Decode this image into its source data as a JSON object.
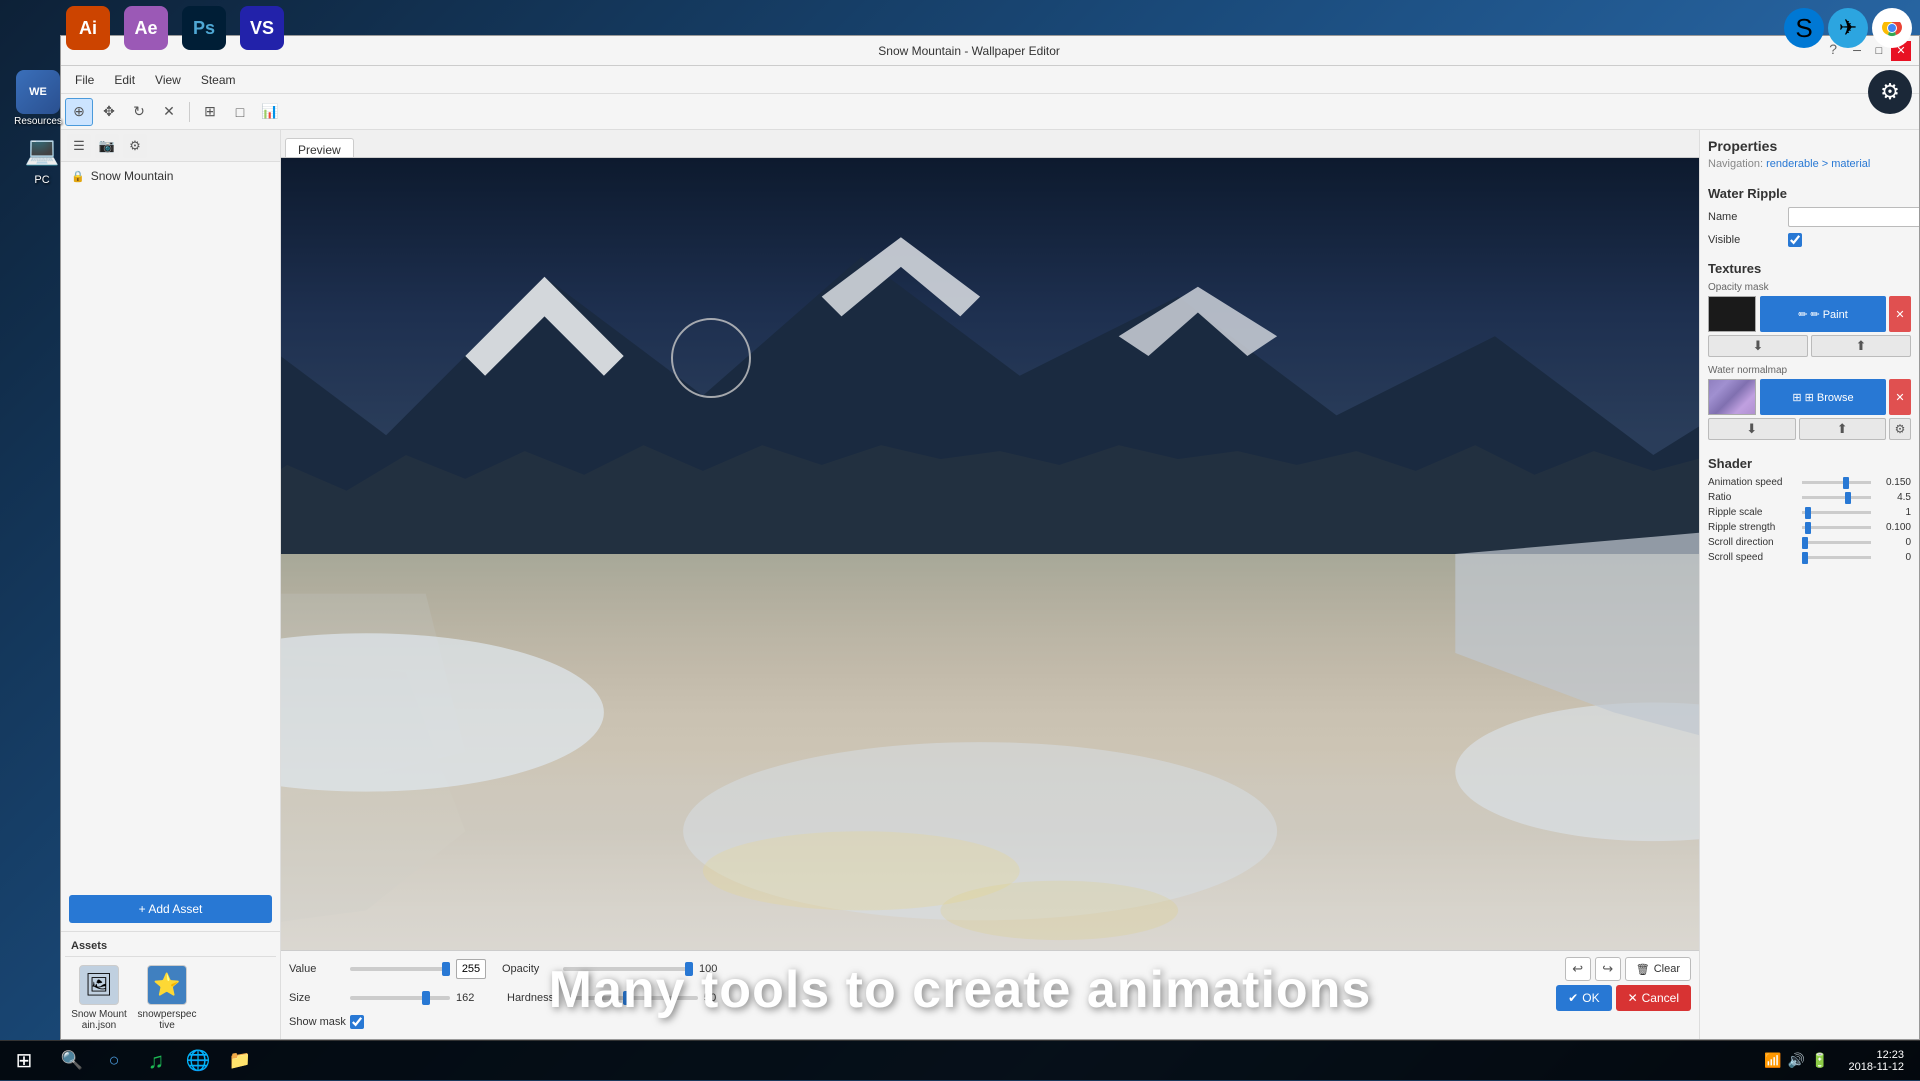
{
  "window": {
    "title": "Snow Mountain - Wallpaper Editor",
    "help_btn": "?",
    "minimize_btn": "─",
    "maximize_btn": "□",
    "close_btn": "✕"
  },
  "menu": {
    "items": [
      "File",
      "Edit",
      "View",
      "Steam"
    ]
  },
  "toolbar": {
    "tools": [
      "⊕",
      "✥",
      "↻",
      "✕",
      "⊞",
      "□",
      "📊"
    ]
  },
  "left_panel": {
    "tools": [
      "☰",
      "📷",
      "⚙"
    ],
    "project_item": "Snow Mountain",
    "add_asset_btn": "+ Add Asset"
  },
  "assets": {
    "label": "Assets",
    "items": [
      {
        "icon": "🖼",
        "label": "Snow Mountain.json"
      },
      {
        "icon": "⭐",
        "label": "snowperspective"
      }
    ]
  },
  "preview": {
    "tab": "Preview"
  },
  "brush_controls": {
    "value_label": "Value",
    "value": "255",
    "size_label": "Size",
    "size": "162",
    "opacity_label": "Opacity",
    "opacity": "100",
    "hardness_label": "Hardness",
    "hardness": "50",
    "show_mask_label": "Show mask",
    "undo_btn": "↩",
    "redo_btn": "↪",
    "clear_btn": "Clear",
    "ok_btn": "OK",
    "cancel_btn": "Cancel"
  },
  "properties": {
    "title": "Properties",
    "nav": "Navigation: renderable > material",
    "nav_link": "renderable > material",
    "section_title": "Water Ripple",
    "name_label": "Name",
    "name_value": "",
    "visible_label": "Visible",
    "textures_title": "Textures",
    "opacity_mask_label": "Opacity mask",
    "paint_btn": "✏ Paint",
    "browse_btn": "⊞ Browse",
    "water_normalmap_label": "Water normalmap",
    "shader_title": "Shader",
    "shader_props": [
      {
        "label": "Animation speed",
        "value": "0.150",
        "thumb_pct": 60
      },
      {
        "label": "Ratio",
        "value": "4.5",
        "thumb_pct": 62
      },
      {
        "label": "Ripple scale",
        "value": "1",
        "thumb_pct": 5
      },
      {
        "label": "Ripple strength",
        "value": "0.100",
        "thumb_pct": 5
      },
      {
        "label": "Scroll direction",
        "value": "0",
        "thumb_pct": 0
      },
      {
        "label": "Scroll speed",
        "value": "0",
        "thumb_pct": 0
      }
    ]
  },
  "taskbar": {
    "time": "12:23",
    "date": "2018-11-12"
  },
  "overlay": {
    "text": "Many tools to create animations"
  },
  "desktop_icons": [
    {
      "icon": "💻",
      "label": "PC"
    }
  ],
  "apps": [
    {
      "bg": "#cc4400",
      "label": "Ai",
      "text_label": "Ai"
    },
    {
      "bg": "#cc0000",
      "label": "Ae",
      "text_label": "Ae"
    },
    {
      "bg": "#220066",
      "label": "Ps",
      "text_label": "Ps"
    },
    {
      "bg": "#2222aa",
      "label": "VS",
      "text_label": "VS"
    }
  ]
}
